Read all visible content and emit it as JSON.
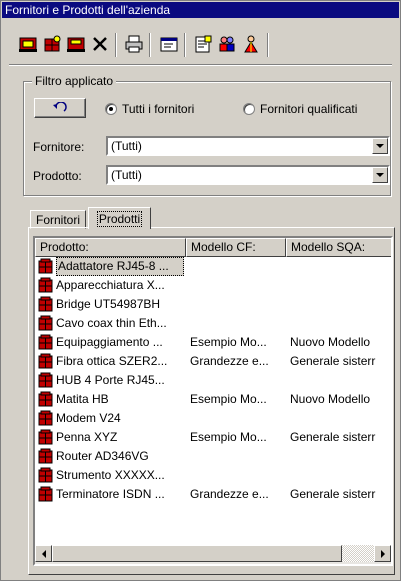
{
  "window": {
    "title": "Fornitori e Prodotti dell'azienda"
  },
  "toolbar": {
    "buttons": [
      {
        "icon": "new-supplier-icon"
      },
      {
        "icon": "new-product-icon"
      },
      {
        "icon": "edit-icon"
      },
      {
        "icon": "delete-icon"
      },
      {
        "icon": "print-icon"
      },
      {
        "icon": "properties-icon"
      },
      {
        "icon": "report-icon"
      },
      {
        "icon": "users-icon"
      },
      {
        "icon": "person-icon"
      }
    ]
  },
  "filter": {
    "legend": "Filtro applicato",
    "radio_all": "Tutti i fornitori",
    "radio_qualified": "Fornitori qualificati",
    "selected_radio": "all",
    "supplier_label": "Fornitore:",
    "supplier_value": "(Tutti)",
    "product_label": "Prodotto:",
    "product_value": "(Tutti)"
  },
  "tabs": [
    {
      "label": "Fornitori",
      "active": false
    },
    {
      "label": "Prodotti",
      "active": true
    }
  ],
  "table": {
    "columns": [
      "Prodotto:",
      "Modello CF:",
      "Modello SQA:"
    ],
    "rows": [
      {
        "product": "Adattatore RJ45-8 ...",
        "cf": "",
        "sqa": "",
        "selected": true
      },
      {
        "product": "Apparecchiatura X...",
        "cf": "",
        "sqa": ""
      },
      {
        "product": "Bridge UT54987BH",
        "cf": "",
        "sqa": ""
      },
      {
        "product": "Cavo coax thin Eth...",
        "cf": "",
        "sqa": ""
      },
      {
        "product": "Equipaggiamento ...",
        "cf": "Esempio Mo...",
        "sqa": "Nuovo Modello"
      },
      {
        "product": "Fibra ottica SZER2...",
        "cf": "Grandezze e...",
        "sqa": "Generale sisterr"
      },
      {
        "product": "HUB 4 Porte RJ45...",
        "cf": "",
        "sqa": ""
      },
      {
        "product": "Matita HB",
        "cf": "Esempio Mo...",
        "sqa": "Nuovo Modello"
      },
      {
        "product": "Modem V24",
        "cf": "",
        "sqa": ""
      },
      {
        "product": "Penna XYZ",
        "cf": "Esempio Mo...",
        "sqa": "Generale sisterr"
      },
      {
        "product": "Router AD346VG",
        "cf": "",
        "sqa": ""
      },
      {
        "product": "Strumento XXXXX...",
        "cf": "",
        "sqa": ""
      },
      {
        "product": "Terminatore ISDN ...",
        "cf": "Grandezze e...",
        "sqa": "Generale sisterr"
      }
    ]
  },
  "colors": {
    "titlebar": "#0a0a80",
    "face": "#d4d0c8",
    "selection_bg": "#d4d0c8"
  }
}
